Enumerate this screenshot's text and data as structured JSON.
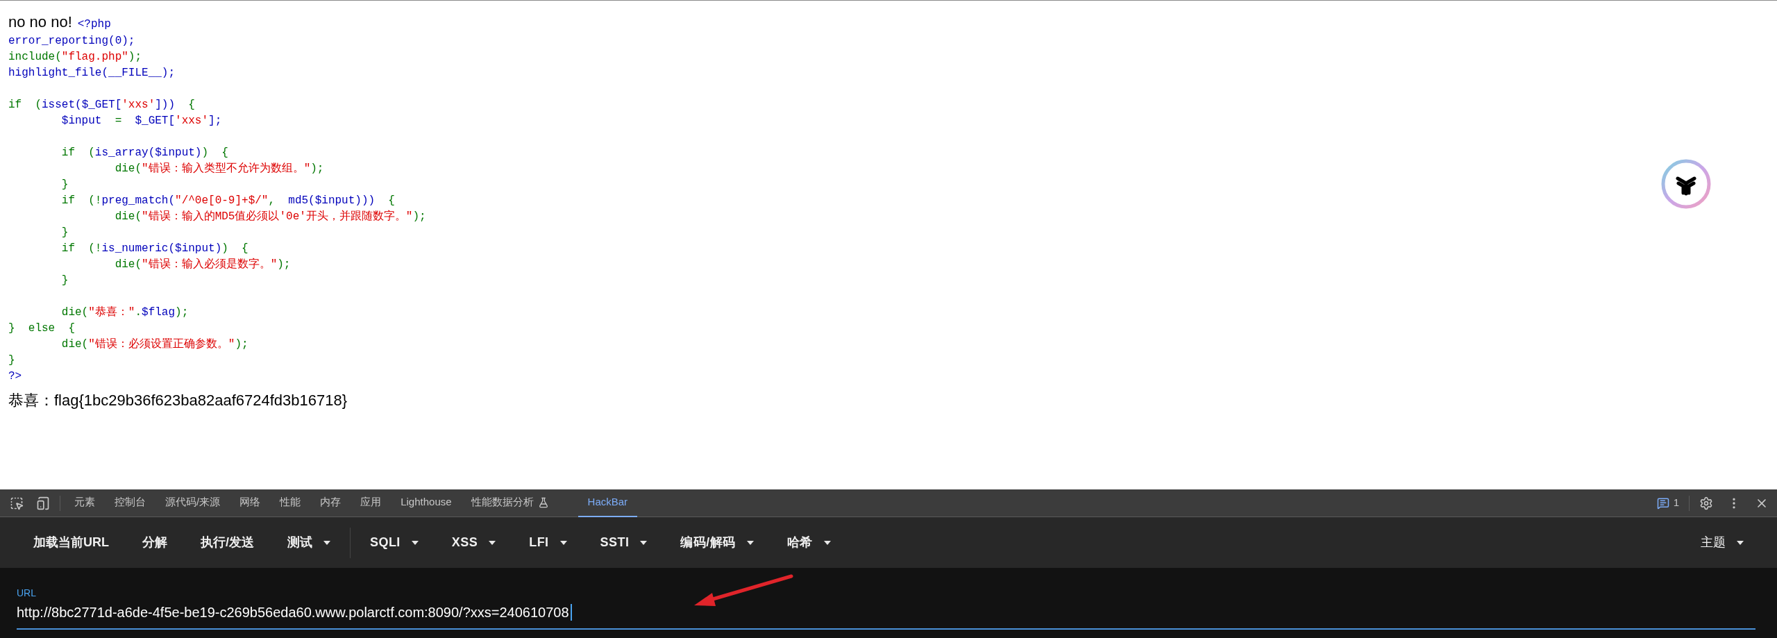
{
  "page": {
    "heading": "no no no!",
    "lines": [
      {
        "tokens": [
          {
            "kind": "default",
            "text": "<?php"
          }
        ]
      },
      {
        "tokens": [
          {
            "kind": "default",
            "text": "error_reporting(0);"
          }
        ]
      },
      {
        "tokens": [
          {
            "kind": "keyword",
            "text": "include("
          },
          {
            "kind": "string",
            "text": "\"flag.php\""
          },
          {
            "kind": "keyword",
            "text": ");"
          }
        ]
      },
      {
        "tokens": [
          {
            "kind": "default",
            "text": "highlight_file(__FILE__);"
          }
        ]
      },
      {
        "kind": "blank"
      },
      {
        "tokens": [
          {
            "kind": "keyword",
            "text": "if  ("
          },
          {
            "kind": "default",
            "text": "isset($_GET["
          },
          {
            "kind": "string",
            "text": "'xxs'"
          },
          {
            "kind": "default",
            "text": "]))"
          },
          {
            "kind": "keyword",
            "text": "  {"
          }
        ]
      },
      {
        "tokens": [
          {
            "kind": "default",
            "text": "        $input"
          },
          {
            "kind": "keyword",
            "text": "  =  "
          },
          {
            "kind": "default",
            "text": "$_GET["
          },
          {
            "kind": "string",
            "text": "'xxs'"
          },
          {
            "kind": "default",
            "text": "];"
          }
        ]
      },
      {
        "kind": "blank"
      },
      {
        "tokens": [
          {
            "kind": "keyword",
            "text": "        if  ("
          },
          {
            "kind": "default",
            "text": "is_array($input)"
          },
          {
            "kind": "keyword",
            "text": ")  {"
          }
        ]
      },
      {
        "tokens": [
          {
            "kind": "keyword",
            "text": "                die("
          },
          {
            "kind": "string",
            "text": "\"错误：输入类型不允许为数组。\""
          },
          {
            "kind": "keyword",
            "text": ");"
          }
        ]
      },
      {
        "tokens": [
          {
            "kind": "keyword",
            "text": "        }"
          }
        ]
      },
      {
        "tokens": [
          {
            "kind": "keyword",
            "text": "        if  (!"
          },
          {
            "kind": "default",
            "text": "preg_match("
          },
          {
            "kind": "string",
            "text": "\"/^0e[0-9]+$/\""
          },
          {
            "kind": "keyword",
            "text": ",  "
          },
          {
            "kind": "default",
            "text": "md5($input)))"
          },
          {
            "kind": "keyword",
            "text": "  {"
          }
        ]
      },
      {
        "tokens": [
          {
            "kind": "keyword",
            "text": "                die("
          },
          {
            "kind": "string",
            "text": "\"错误：输入的MD5值必须以'0e'开头，并跟随数字。\""
          },
          {
            "kind": "keyword",
            "text": ");"
          }
        ]
      },
      {
        "tokens": [
          {
            "kind": "keyword",
            "text": "        }"
          }
        ]
      },
      {
        "tokens": [
          {
            "kind": "keyword",
            "text": "        if  (!"
          },
          {
            "kind": "default",
            "text": "is_numeric($input)"
          },
          {
            "kind": "keyword",
            "text": ")  {"
          }
        ]
      },
      {
        "tokens": [
          {
            "kind": "keyword",
            "text": "                die("
          },
          {
            "kind": "string",
            "text": "\"错误：输入必须是数字。\""
          },
          {
            "kind": "keyword",
            "text": ");"
          }
        ]
      },
      {
        "tokens": [
          {
            "kind": "keyword",
            "text": "        }"
          }
        ]
      },
      {
        "kind": "blank"
      },
      {
        "tokens": [
          {
            "kind": "keyword",
            "text": "        die("
          },
          {
            "kind": "string",
            "text": "\"恭喜：\""
          },
          {
            "kind": "keyword",
            "text": "."
          },
          {
            "kind": "default",
            "text": "$flag"
          },
          {
            "kind": "keyword",
            "text": ");"
          }
        ]
      },
      {
        "tokens": [
          {
            "kind": "keyword",
            "text": "}  else  {"
          }
        ]
      },
      {
        "tokens": [
          {
            "kind": "keyword",
            "text": "        die("
          },
          {
            "kind": "string",
            "text": "\"错误：必须设置正确参数。\""
          },
          {
            "kind": "keyword",
            "text": ");"
          }
        ]
      },
      {
        "tokens": [
          {
            "kind": "keyword",
            "text": "}"
          }
        ]
      },
      {
        "tokens": [
          {
            "kind": "default",
            "text": "?>"
          }
        ]
      }
    ],
    "result": "恭喜：flag{1bc29b36f623ba82aaf6724fd3b16718}"
  },
  "devtools": {
    "tabs": [
      {
        "label": "元素",
        "selected": false
      },
      {
        "label": "控制台",
        "selected": false
      },
      {
        "label": "源代码/来源",
        "selected": false
      },
      {
        "label": "网络",
        "selected": false
      },
      {
        "label": "性能",
        "selected": false
      },
      {
        "label": "内存",
        "selected": false
      },
      {
        "label": "应用",
        "selected": false
      },
      {
        "label": "Lighthouse",
        "selected": false
      },
      {
        "label": "性能数据分析",
        "selected": false,
        "experimental": true
      },
      {
        "label": "HackBar",
        "selected": true
      }
    ],
    "issues_count": "1"
  },
  "hackbar": {
    "actions": [
      {
        "label": "加载当前URL",
        "dropdown": false
      },
      {
        "label": "分解",
        "dropdown": false
      },
      {
        "label": "执行/发送",
        "dropdown": false
      },
      {
        "label": "测试",
        "dropdown": true
      }
    ],
    "menus": [
      {
        "label": "SQLI"
      },
      {
        "label": "XSS"
      },
      {
        "label": "LFI"
      },
      {
        "label": "SSTI"
      },
      {
        "label": "编码/解码"
      },
      {
        "label": "哈希"
      }
    ],
    "theme": "主题",
    "url_field": {
      "label": "URL",
      "value": "http://8bc2771d-a6de-4f5e-be19-c269b56eda60.www.polarctf.com:8090/?xxs=240610708"
    }
  }
}
